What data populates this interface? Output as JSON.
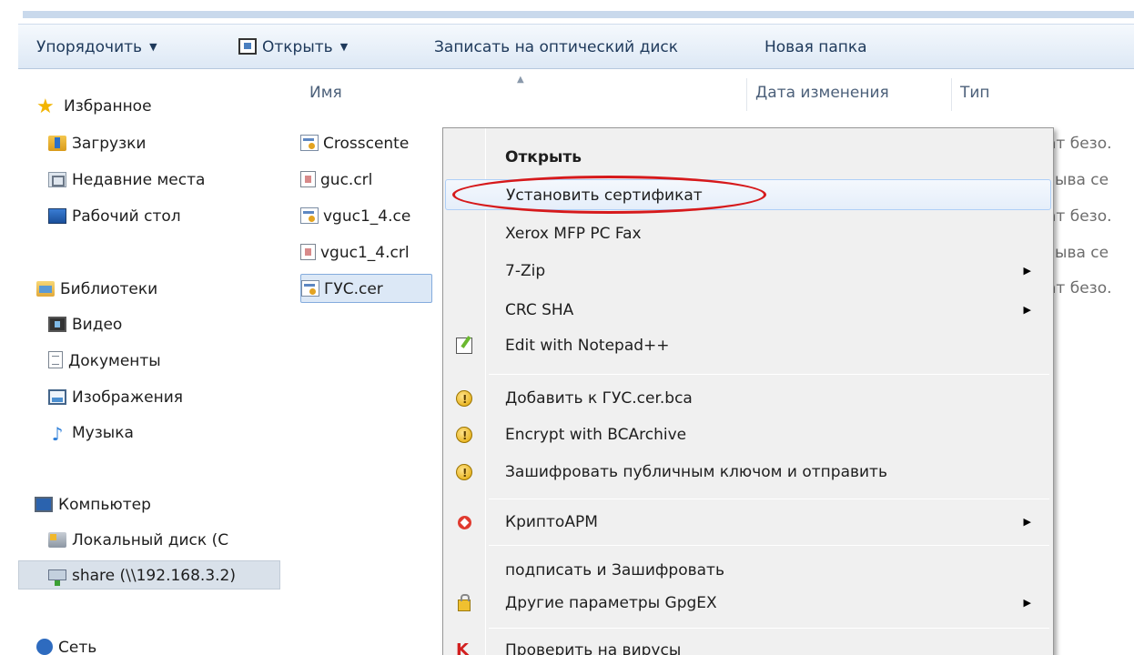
{
  "toolbar": {
    "organize": "Упорядочить",
    "open": "Открыть",
    "burn": "Записать на оптический диск",
    "new_folder": "Новая папка"
  },
  "nav": {
    "favorites": "Избранное",
    "downloads": "Загрузки",
    "recent": "Недавние места",
    "desktop": "Рабочий стол",
    "libraries": "Библиотеки",
    "video": "Видео",
    "documents": "Документы",
    "images": "Изображения",
    "music": "Музыка",
    "computer": "Компьютер",
    "local_disk": "Локальный диск (С",
    "share": "share (\\\\192.168.3.2)",
    "network": "Сеть"
  },
  "columns": {
    "name": "Имя",
    "modified": "Дата изменения",
    "type": "Тип"
  },
  "files": [
    {
      "name": "Crosscente",
      "type": "ат безо."
    },
    {
      "name": "guc.crl",
      "type": "зыва се"
    },
    {
      "name": "vguc1_4.ce",
      "type": "ат безо."
    },
    {
      "name": "vguc1_4.crl",
      "type": "зыва се"
    },
    {
      "name": "ГУС.cer",
      "type": "ат безо."
    }
  ],
  "context_menu": {
    "open": "Открыть",
    "install_cert": "Установить сертификат",
    "xerox": "Xerox MFP PC Fax",
    "zip": "7-Zip",
    "crc": "CRC SHA",
    "notepad": "Edit with Notepad++",
    "add_bca": "Добавить к ГУС.cer.bca",
    "encrypt_bca": "Encrypt with BCArchive",
    "encrypt_pub": "Зашифровать публичным ключом и отправить",
    "cryptoarm": "КриптоАРМ",
    "sign_encrypt": "подписать и Зашифровать",
    "gpgex": "Другие параметры GpgEX",
    "scan": "Проверить на вирусы"
  },
  "icons": {
    "favorites": "star-icon",
    "submenu": "submenu-arrow-icon"
  },
  "colors": {
    "annotation": "#d6191b",
    "menu_background": "#f0f0f0",
    "toolbar": "#dde8f5"
  }
}
